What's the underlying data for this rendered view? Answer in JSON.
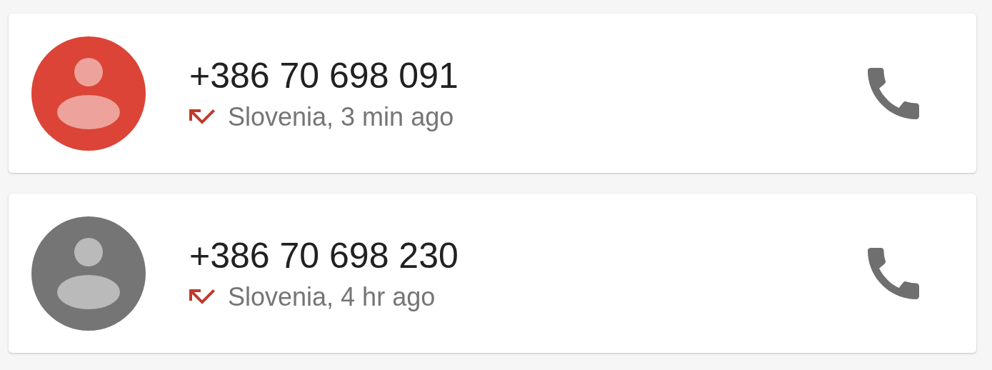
{
  "calls": [
    {
      "number": "+386 70 698 091",
      "missed": true,
      "details": "Slovenia, 3 min ago",
      "color": "#db4437"
    },
    {
      "number": "+386 70 698 230",
      "missed": true,
      "details": "Slovenia, 4 hr ago",
      "color": "#757575"
    }
  ]
}
